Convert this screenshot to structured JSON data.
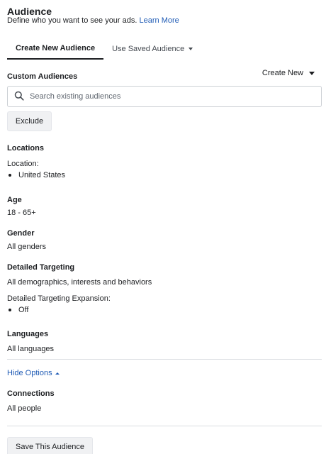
{
  "header": {
    "title": "Audience",
    "subtitle": "Define who you want to see your ads.",
    "learn_more": "Learn More"
  },
  "tabs": [
    {
      "label": "Create New Audience",
      "active": true
    },
    {
      "label": "Use Saved Audience",
      "active": false
    }
  ],
  "custom_audiences": {
    "label": "Custom Audiences",
    "create_new": "Create New",
    "search_placeholder": "Search existing audiences",
    "exclude_label": "Exclude"
  },
  "locations": {
    "label": "Locations",
    "sublabel": "Location:",
    "items": [
      "United States"
    ]
  },
  "age": {
    "label": "Age",
    "value": "18 - 65+"
  },
  "gender": {
    "label": "Gender",
    "value": "All genders"
  },
  "detailed_targeting": {
    "label": "Detailed Targeting",
    "value": "All demographics, interests and behaviors",
    "expansion_label": "Detailed Targeting Expansion:",
    "expansion_items": [
      "Off"
    ]
  },
  "languages": {
    "label": "Languages",
    "value": "All languages"
  },
  "hide_options": "Hide Options",
  "connections": {
    "label": "Connections",
    "value": "All people"
  },
  "save_label": "Save This Audience",
  "colors": {
    "link": "#1f5bb5",
    "text": "#1c1e21",
    "border": "#ccd0d5"
  }
}
